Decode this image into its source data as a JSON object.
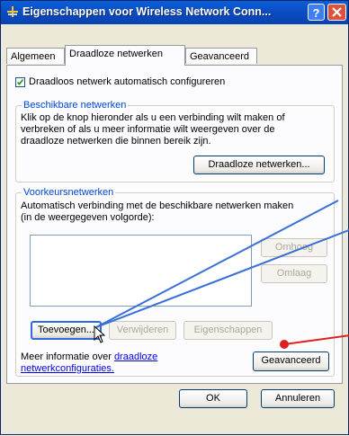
{
  "window": {
    "title": "Eigenschappen voor Wireless Network Conn...",
    "help_label": "?"
  },
  "tabs": [
    {
      "label": "Algemeen"
    },
    {
      "label": "Draadloze netwerken"
    },
    {
      "label": "Geavanceerd"
    }
  ],
  "auto_config": {
    "label": "Draadloos netwerk automatisch configureren",
    "checked": true
  },
  "available": {
    "title": "Beschikbare netwerken",
    "description_lines": [
      "Klik op de knop hieronder als u een verbinding wilt maken of",
      "verbreken of als u meer informatie wilt weergeven over de",
      "draadloze netwerken die binnen bereik zijn."
    ],
    "button_label": "Draadloze netwerken..."
  },
  "preferred": {
    "title": "Voorkeursnetwerken",
    "description_lines": [
      "Automatisch verbinding met de beschikbare netwerken maken",
      "(in de weergegeven volgorde):"
    ],
    "up_label": "Omhoog",
    "down_label": "Omlaag",
    "add_label": "Toevoegen...",
    "remove_label": "Verwijderen",
    "properties_label": "Eigenschappen"
  },
  "info": {
    "prefix": "Meer informatie over ",
    "link_part1": "draadloze",
    "link_part2": "netwerkconfiguraties."
  },
  "advanced_button_label": "Geavanceerd",
  "footer": {
    "ok_label": "OK",
    "cancel_label": "Annuleren"
  },
  "colors": {
    "annotation_line": "#3a6fd8",
    "annotation_red": "#e02020"
  }
}
